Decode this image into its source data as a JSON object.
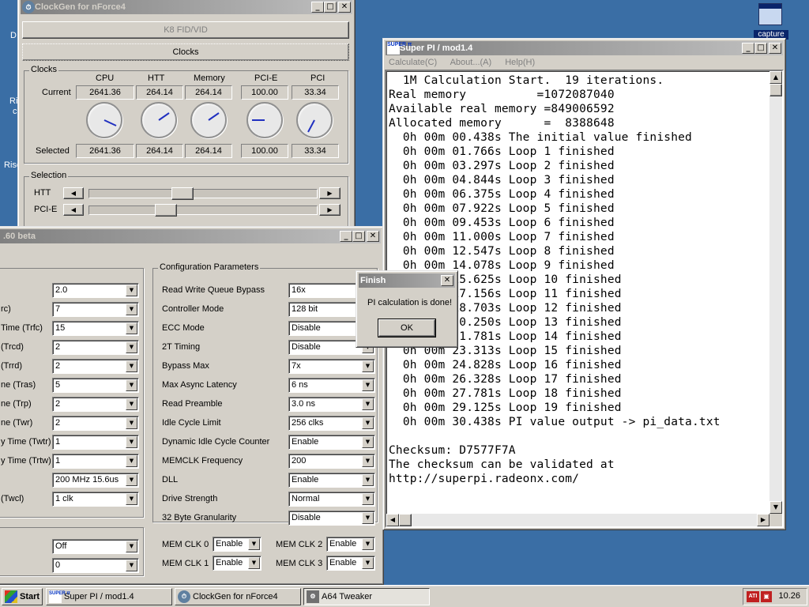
{
  "desktop": {
    "left_labels": [
      "D",
      "Ri",
      "c",
      "Risc"
    ],
    "capture_icon_label": "capture"
  },
  "clockgen": {
    "title": "ClockGen for nForce4",
    "fid_button": "K8 FID/VID",
    "clocks_tab": "Clocks",
    "group_clocks": "Clocks",
    "columns": [
      "CPU",
      "HTT",
      "Memory",
      "PCI-E",
      "PCI"
    ],
    "row_current": "Current",
    "row_selected": "Selected",
    "current": [
      "2641.36",
      "264.14",
      "264.14",
      "100.00",
      "33.34"
    ],
    "selected": [
      "2641.36",
      "264.14",
      "264.14",
      "100.00",
      "33.34"
    ],
    "group_selection": "Selection",
    "sliders": [
      {
        "label": "HTT",
        "level": 0.42
      },
      {
        "label": "PCI-E",
        "level": 0.34
      }
    ]
  },
  "a64": {
    "title": ".60 beta",
    "left_labels": [
      "",
      "rc)",
      " Time (Trfc)",
      "(Trcd)",
      "(Trrd)",
      "ne (Tras)",
      "ne (Trp)",
      "ne (Twr)",
      "y Time (Twtr)",
      "y Time (Trtw)",
      "",
      "(Twcl)"
    ],
    "left_values": [
      "2.0",
      "7",
      "15",
      "2",
      "2",
      "5",
      "2",
      "2",
      "1",
      "1",
      "200 MHz 15.6us",
      "1 clk"
    ],
    "bottom_values": [
      "Off",
      "0"
    ],
    "group_config": "Configuration Parameters",
    "config": [
      {
        "label": "Read Write Queue Bypass",
        "value": "16x"
      },
      {
        "label": "Controller Mode",
        "value": "128 bit"
      },
      {
        "label": "ECC Mode",
        "value": "Disable"
      },
      {
        "label": "2T Timing",
        "value": "Disable"
      },
      {
        "label": "Bypass Max",
        "value": "7x"
      },
      {
        "label": "Max Async Latency",
        "value": "6 ns"
      },
      {
        "label": "Read Preamble",
        "value": "3.0 ns"
      },
      {
        "label": "Idle Cycle Limit",
        "value": "256 clks"
      },
      {
        "label": "Dynamic Idle Cycle Counter",
        "value": "Enable"
      },
      {
        "label": "MEMCLK Frequency",
        "value": "200"
      },
      {
        "label": "DLL",
        "value": "Enable"
      },
      {
        "label": "Drive Strength",
        "value": "Normal"
      },
      {
        "label": "32 Byte Granularity",
        "value": "Disable"
      }
    ],
    "memclk": [
      {
        "label": "MEM CLK 0",
        "value": "Enable"
      },
      {
        "label": "MEM CLK 1",
        "value": "Enable"
      },
      {
        "label": "MEM CLK 2",
        "value": "Enable"
      },
      {
        "label": "MEM CLK 3",
        "value": "Enable"
      }
    ]
  },
  "superpi": {
    "title": "Super PI / mod1.4",
    "menu": [
      "Calculate(C)",
      "About...(A)",
      "Help(H)"
    ],
    "lines": [
      "  1M Calculation Start.  19 iterations.",
      "Real memory          =1072087040",
      "Available real memory =849006592",
      "Allocated memory      =  8388648",
      "  0h 00m 00.438s The initial value finished",
      "  0h 00m 01.766s Loop 1 finished",
      "  0h 00m 03.297s Loop 2 finished",
      "  0h 00m 04.844s Loop 3 finished",
      "  0h 00m 06.375s Loop 4 finished",
      "  0h 00m 07.922s Loop 5 finished",
      "  0h 00m 09.453s Loop 6 finished",
      "  0h 00m 11.000s Loop 7 finished",
      "  0h 00m 12.547s Loop 8 finished",
      "  0h 00m 14.078s Loop 9 finished",
      "  0h 00m 15.625s Loop 10 finished",
      "  0h 00m 17.156s Loop 11 finished",
      "  0h 00m 18.703s Loop 12 finished",
      "  0h 00m 20.250s Loop 13 finished",
      "  0h 00m 21.781s Loop 14 finished",
      "  0h 00m 23.313s Loop 15 finished",
      "  0h 00m 24.828s Loop 16 finished",
      "  0h 00m 26.328s Loop 17 finished",
      "  0h 00m 27.781s Loop 18 finished",
      "  0h 00m 29.125s Loop 19 finished",
      "  0h 00m 30.438s PI value output -> pi_data.txt",
      "",
      "Checksum: D7577F7A",
      "The checksum can be validated at",
      "http://superpi.radeonx.com/"
    ]
  },
  "finish_dialog": {
    "title": "Finish",
    "message": "PI calculation is done!",
    "ok": "OK"
  },
  "taskbar": {
    "start": "Start",
    "items": [
      "Super PI / mod1.4",
      "ClockGen for nForce4",
      "A64 Tweaker"
    ],
    "clock": "10.26"
  }
}
